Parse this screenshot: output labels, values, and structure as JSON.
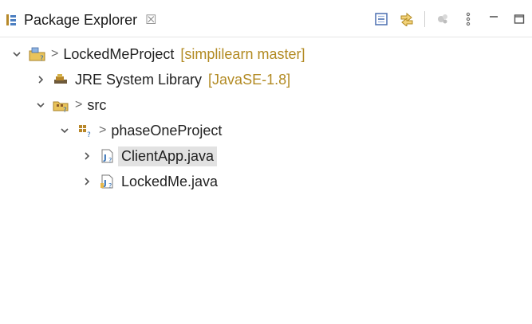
{
  "header": {
    "view_title": "Package Explorer",
    "close_glyph": "☒",
    "toolbar": [
      {
        "icon": "collapse-all-icon"
      },
      {
        "icon": "link-with-editor-icon"
      },
      {
        "icon": "focus-on-active-task-icon"
      },
      {
        "icon": "view-menu-icon"
      },
      {
        "icon": "minimize-icon"
      },
      {
        "icon": "maximize-icon"
      }
    ]
  },
  "tree": [
    {
      "label": "LockedMeProject",
      "decoration": "[simplilearn master]",
      "outgoing_arrow": ">",
      "expanded": true,
      "icon": "project-icon"
    },
    {
      "label": "JRE System Library",
      "decoration": "[JavaSE-1.8]",
      "outgoing_arrow": "",
      "expanded": false,
      "icon": "library-icon"
    },
    {
      "label": "src",
      "decoration": "",
      "outgoing_arrow": ">",
      "expanded": true,
      "icon": "source-folder-icon"
    },
    {
      "label": "phaseOneProject",
      "decoration": "",
      "outgoing_arrow": ">",
      "expanded": true,
      "icon": "package-icon"
    },
    {
      "label": "ClientApp.java",
      "decoration": "",
      "outgoing_arrow": "",
      "expanded": false,
      "icon": "java-file-icon",
      "selected": true
    },
    {
      "label": "LockedMe.java",
      "decoration": "",
      "outgoing_arrow": "",
      "expanded": false,
      "icon": "java-file-icon"
    }
  ],
  "colors": {
    "decoration": "#b28a22",
    "selection": "#e2e2e2",
    "accent": "#2f6fbf"
  }
}
